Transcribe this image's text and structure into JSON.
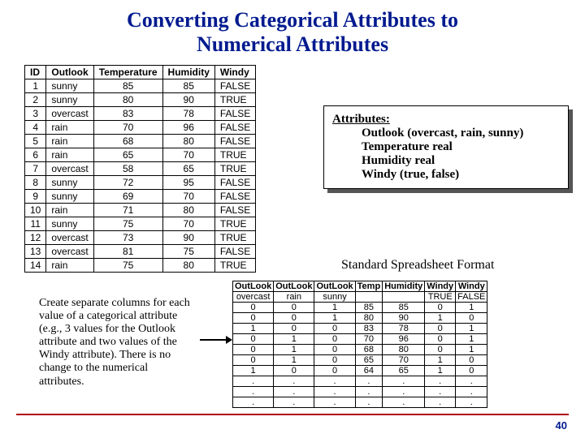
{
  "title_line1": "Converting Categorical Attributes to",
  "title_line2": "Numerical Attributes",
  "table1": {
    "headers": [
      "ID",
      "Outlook",
      "Temperature",
      "Humidity",
      "Windy"
    ],
    "rows": [
      [
        "1",
        "sunny",
        "85",
        "85",
        "FALSE"
      ],
      [
        "2",
        "sunny",
        "80",
        "90",
        "TRUE"
      ],
      [
        "3",
        "overcast",
        "83",
        "78",
        "FALSE"
      ],
      [
        "4",
        "rain",
        "70",
        "96",
        "FALSE"
      ],
      [
        "5",
        "rain",
        "68",
        "80",
        "FALSE"
      ],
      [
        "6",
        "rain",
        "65",
        "70",
        "TRUE"
      ],
      [
        "7",
        "overcast",
        "58",
        "65",
        "TRUE"
      ],
      [
        "8",
        "sunny",
        "72",
        "95",
        "FALSE"
      ],
      [
        "9",
        "sunny",
        "69",
        "70",
        "FALSE"
      ],
      [
        "10",
        "rain",
        "71",
        "80",
        "FALSE"
      ],
      [
        "11",
        "sunny",
        "75",
        "70",
        "TRUE"
      ],
      [
        "12",
        "overcast",
        "73",
        "90",
        "TRUE"
      ],
      [
        "13",
        "overcast",
        "81",
        "75",
        "FALSE"
      ],
      [
        "14",
        "rain",
        "75",
        "80",
        "TRUE"
      ]
    ]
  },
  "attr_box": {
    "head": "Attributes:",
    "l1": "Outlook (overcast, rain, sunny)",
    "l2": "Temperature real",
    "l3": "Humidity real",
    "l4": "Windy (true, false)"
  },
  "caption2": "Standard Spreadsheet Format",
  "paragraph": "Create separate columns for each value of a categorical attribute (e.g., 3 values for the Outlook attribute and two values of the Windy attribute). There is no change to the numerical attributes.",
  "table2": {
    "head_top": [
      "OutLook",
      "OutLook",
      "OutLook",
      "Temp",
      "Humidity",
      "Windy",
      "Windy"
    ],
    "head_sub": [
      "overcast",
      "rain",
      "sunny",
      "",
      "",
      "TRUE",
      "FALSE"
    ],
    "rows": [
      [
        "0",
        "0",
        "1",
        "85",
        "85",
        "0",
        "1"
      ],
      [
        "0",
        "0",
        "1",
        "80",
        "90",
        "1",
        "0"
      ],
      [
        "1",
        "0",
        "0",
        "83",
        "78",
        "0",
        "1"
      ],
      [
        "0",
        "1",
        "0",
        "70",
        "96",
        "0",
        "1"
      ],
      [
        "0",
        "1",
        "0",
        "68",
        "80",
        "0",
        "1"
      ],
      [
        "0",
        "1",
        "0",
        "65",
        "70",
        "1",
        "0"
      ],
      [
        "1",
        "0",
        "0",
        "64",
        "65",
        "1",
        "0"
      ],
      [
        ".",
        ".",
        ".",
        ".",
        ".",
        ".",
        "."
      ],
      [
        ".",
        ".",
        ".",
        ".",
        ".",
        ".",
        "."
      ],
      [
        ".",
        ".",
        ".",
        ".",
        ".",
        ".",
        "."
      ]
    ]
  },
  "pagenum": "40",
  "chart_data": {
    "type": "table",
    "title": "Converting Categorical Attributes to Numerical Attributes",
    "source_table": {
      "columns": [
        "ID",
        "Outlook",
        "Temperature",
        "Humidity",
        "Windy"
      ],
      "rows": [
        [
          1,
          "sunny",
          85,
          85,
          "FALSE"
        ],
        [
          2,
          "sunny",
          80,
          90,
          "TRUE"
        ],
        [
          3,
          "overcast",
          83,
          78,
          "FALSE"
        ],
        [
          4,
          "rain",
          70,
          96,
          "FALSE"
        ],
        [
          5,
          "rain",
          68,
          80,
          "FALSE"
        ],
        [
          6,
          "rain",
          65,
          70,
          "TRUE"
        ],
        [
          7,
          "overcast",
          58,
          65,
          "TRUE"
        ],
        [
          8,
          "sunny",
          72,
          95,
          "FALSE"
        ],
        [
          9,
          "sunny",
          69,
          70,
          "FALSE"
        ],
        [
          10,
          "rain",
          71,
          80,
          "FALSE"
        ],
        [
          11,
          "sunny",
          75,
          70,
          "TRUE"
        ],
        [
          12,
          "overcast",
          73,
          90,
          "TRUE"
        ],
        [
          13,
          "overcast",
          81,
          75,
          "FALSE"
        ],
        [
          14,
          "rain",
          75,
          80,
          "TRUE"
        ]
      ]
    },
    "converted_table": {
      "columns": [
        "OutLook overcast",
        "OutLook rain",
        "OutLook sunny",
        "Temp",
        "Humidity",
        "Windy TRUE",
        "Windy FALSE"
      ],
      "rows": [
        [
          0,
          0,
          1,
          85,
          85,
          0,
          1
        ],
        [
          0,
          0,
          1,
          80,
          90,
          1,
          0
        ],
        [
          1,
          0,
          0,
          83,
          78,
          0,
          1
        ],
        [
          0,
          1,
          0,
          70,
          96,
          0,
          1
        ],
        [
          0,
          1,
          0,
          68,
          80,
          0,
          1
        ],
        [
          0,
          1,
          0,
          65,
          70,
          1,
          0
        ],
        [
          1,
          0,
          0,
          64,
          65,
          1,
          0
        ]
      ]
    }
  }
}
